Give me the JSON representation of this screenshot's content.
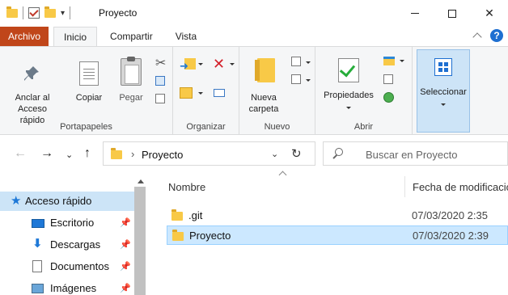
{
  "window": {
    "title": "Proyecto",
    "quick_access_dropdown": "▾"
  },
  "ribbon_tabs": {
    "file": "Archivo",
    "home": "Inicio",
    "share": "Compartir",
    "view": "Vista",
    "help": "?"
  },
  "ribbon": {
    "clipboard": {
      "label": "Portapapeles",
      "pin_line1": "Anclar al",
      "pin_line2": "Acceso rápido",
      "copy": "Copiar",
      "paste": "Pegar"
    },
    "organize": {
      "label": "Organizar"
    },
    "new": {
      "label": "Nuevo",
      "folder_line1": "Nueva",
      "folder_line2": "carpeta"
    },
    "open": {
      "label": "Abrir",
      "properties": "Propiedades"
    },
    "select": {
      "label": "Seleccionar"
    }
  },
  "address": {
    "path": "Proyecto",
    "search_placeholder": "Buscar en Proyecto"
  },
  "nav_pane": {
    "items": [
      {
        "label": "Acceso rápido"
      },
      {
        "label": "Escritorio"
      },
      {
        "label": "Descargas"
      },
      {
        "label": "Documentos"
      },
      {
        "label": "Imágenes"
      }
    ]
  },
  "file_list": {
    "columns": {
      "name": "Nombre",
      "date": "Fecha de modificación"
    },
    "rows": [
      {
        "name": ".git",
        "date": "07/03/2020 2:35"
      },
      {
        "name": "Proyecto",
        "date": "07/03/2020 2:39"
      }
    ]
  },
  "colors": {
    "file_tab": "#c0461a",
    "selection": "#cce8ff",
    "accent": "#1e78d7",
    "folder": "#f8c947"
  },
  "icons": [
    "folder-icon",
    "checkbox-icon",
    "pin-icon",
    "copy-icon",
    "paste-icon",
    "cut-icon",
    "move-to-icon",
    "delete-icon",
    "copy-to-icon",
    "rename-icon",
    "new-folder-icon",
    "new-item-icon",
    "properties-icon",
    "open-icon",
    "select-icon",
    "search-icon",
    "refresh-icon",
    "star-icon",
    "desktop-icon",
    "download-icon",
    "documents-icon",
    "images-icon"
  ]
}
